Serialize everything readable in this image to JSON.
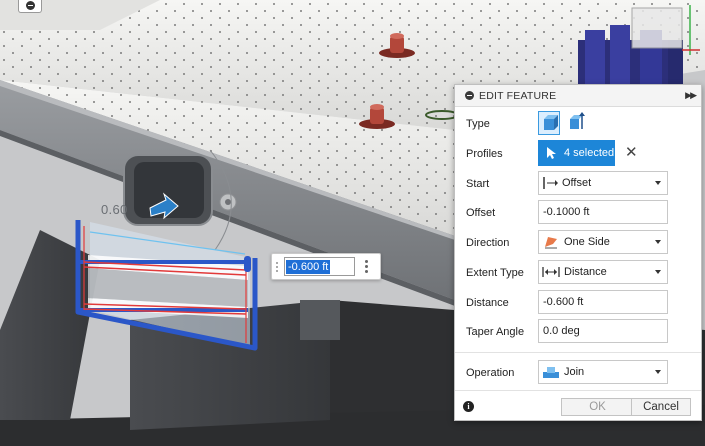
{
  "viewport": {
    "dimension_label": "0.60",
    "dimension_input_value": "-0.600 ft"
  },
  "panel": {
    "title": "EDIT FEATURE",
    "type_label": "Type",
    "profiles_label": "Profiles",
    "profiles_value": "4 selected",
    "start_label": "Start",
    "start_value": "Offset",
    "offset_label": "Offset",
    "offset_value": "-0.1000 ft",
    "direction_label": "Direction",
    "direction_value": "One Side",
    "extent_type_label": "Extent Type",
    "extent_type_value": "Distance",
    "distance_label": "Distance",
    "distance_value": "-0.600 ft",
    "taper_angle_label": "Taper Angle",
    "taper_angle_value": "0.0 deg",
    "operation_label": "Operation",
    "operation_value": "Join",
    "ok_label": "OK",
    "cancel_label": "Cancel"
  },
  "colors": {
    "accent": "#1d86d8",
    "selection_blue": "#2b57c8",
    "selection_red": "#e23a3a"
  }
}
